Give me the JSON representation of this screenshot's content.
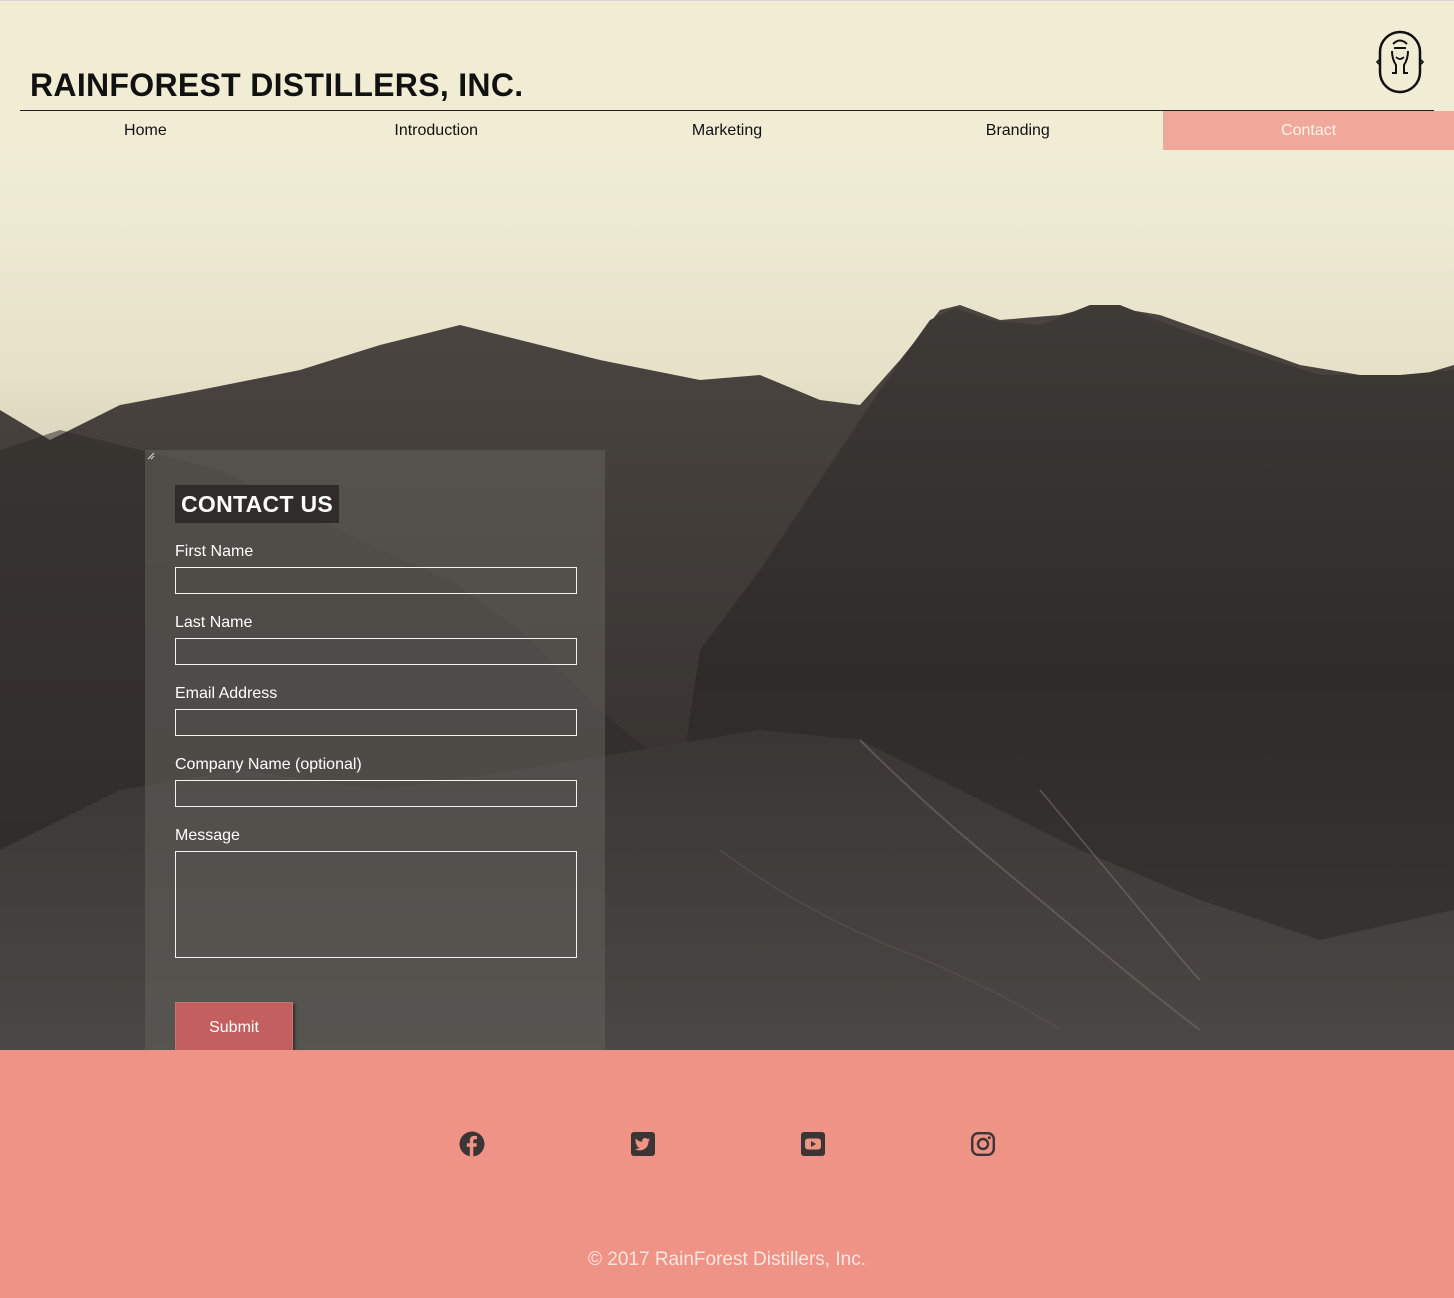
{
  "header": {
    "title": "RAINFOREST DISTILLERS, INC.",
    "logo_icon": "bottle-logo-icon"
  },
  "nav": {
    "items": [
      {
        "label": "Home",
        "active": false
      },
      {
        "label": "Introduction",
        "active": false
      },
      {
        "label": "Marketing",
        "active": false
      },
      {
        "label": "Branding",
        "active": false
      },
      {
        "label": "Contact",
        "active": true
      }
    ]
  },
  "form": {
    "heading": "CONTACT US",
    "fields": [
      {
        "label": "First Name",
        "value": "",
        "placeholder": ""
      },
      {
        "label": "Last Name",
        "value": "",
        "placeholder": ""
      },
      {
        "label": "Email Address",
        "value": "",
        "placeholder": ""
      },
      {
        "label": "Company Name (optional)",
        "value": "",
        "placeholder": ""
      }
    ],
    "message": {
      "label": "Message",
      "value": "",
      "placeholder": ""
    },
    "submit_label": "Submit"
  },
  "footer": {
    "social": [
      "facebook-icon",
      "twitter-icon",
      "youtube-icon",
      "instagram-icon"
    ],
    "copyright": "© 2017 RainForest Distillers, Inc."
  },
  "colors": {
    "header_bg": "#f1edd4",
    "nav_active_bg": "#efa89a",
    "submit_bg": "#c45f5f",
    "footer_bg": "#ef9387",
    "icon_color": "#3b3535"
  }
}
